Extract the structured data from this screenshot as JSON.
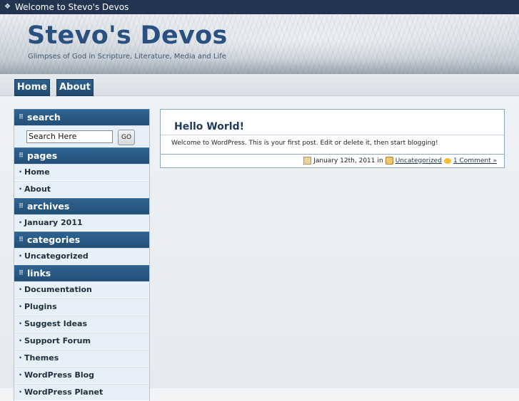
{
  "topbar": {
    "text": "Welcome to Stevo's Devos"
  },
  "header": {
    "title": "Stevo's Devos",
    "tagline": "Glimpses of God in Scripture, Literature, Media and Life"
  },
  "nav": {
    "items": [
      {
        "label": "Home"
      },
      {
        "label": "About"
      }
    ]
  },
  "sidebar": {
    "search": {
      "heading": "search",
      "value": "Search Here",
      "button": "GO"
    },
    "pages": {
      "heading": "pages",
      "items": [
        "Home",
        "About"
      ]
    },
    "archives": {
      "heading": "archives",
      "items": [
        "January 2011"
      ]
    },
    "categories": {
      "heading": "categories",
      "items": [
        "Uncategorized"
      ]
    },
    "links": {
      "heading": "links",
      "items": [
        "Documentation",
        "Plugins",
        "Suggest Ideas",
        "Support Forum",
        "Themes",
        "WordPress Blog",
        "WordPress Planet"
      ]
    }
  },
  "post": {
    "title": "Hello World!",
    "body": "Welcome to WordPress. This is your first post. Edit or delete it, then start blogging!",
    "date": "January 12th, 2011",
    "in_label": "in",
    "category": "Uncategorized",
    "comments": "1 Comment »"
  }
}
